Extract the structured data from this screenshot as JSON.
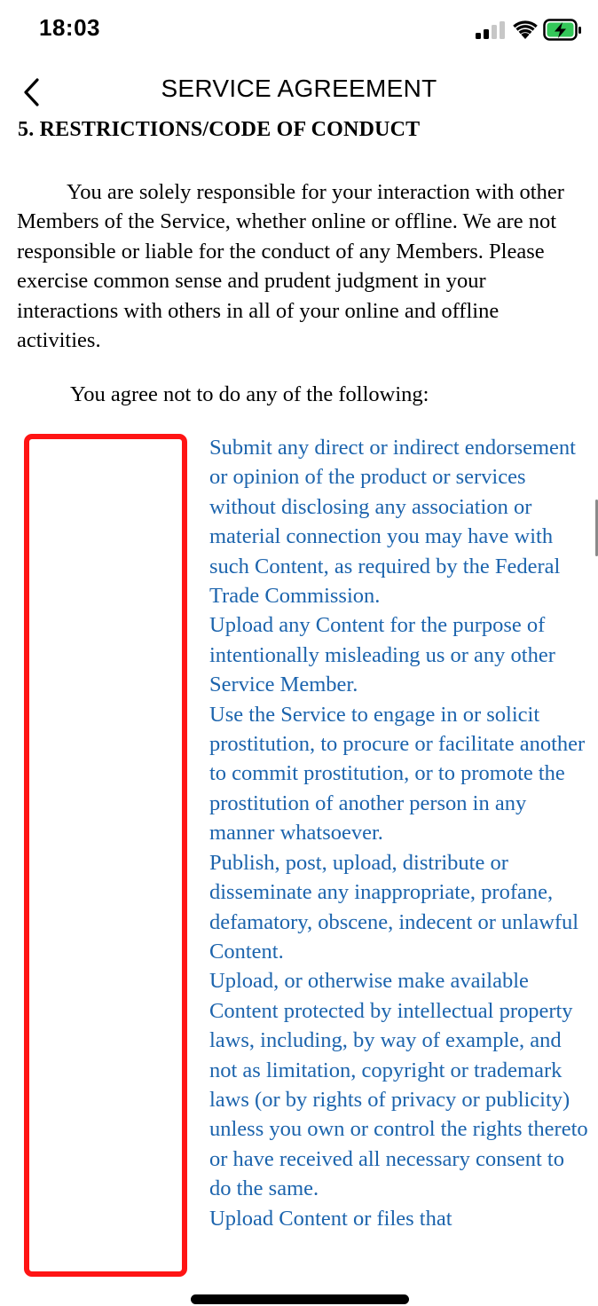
{
  "status_bar": {
    "time": "18:03",
    "icons": [
      "signal-icon",
      "wifi-icon",
      "battery-charging-icon"
    ]
  },
  "header": {
    "title": "SERVICE AGREEMENT",
    "back_icon": "chevron-left-icon"
  },
  "document": {
    "section_heading": "5.  RESTRICTIONS/CODE OF CONDUCT",
    "paragraphs": [
      "You are solely responsible for your interaction with other Members of the Service, whether online or offline. We are not responsible or liable for the conduct of any Members. Please exercise common sense and prudent judgment in your interactions with others in all of your online and offline activities.",
      "You agree not to do any of the following:"
    ],
    "restrictions": [
      "Submit any direct or indirect endorsement or opinion of the product or services without disclosing any association or material connection you may have with such Content, as required by the Federal Trade Commission.",
      "Upload any Content for the purpose of intentionally misleading us or any other Service Member.",
      "Use the Service to engage in or solicit prostitution, to procure or facilitate another to commit prostitution, or to promote the prostitution of another person in any manner whatsoever.",
      "Publish, post, upload, distribute or disseminate any inappropriate, profane, defamatory, obscene, indecent or unlawful Content.",
      "Upload, or otherwise make available Content protected by intellectual property laws, including, by way of example, and not as limitation, copyright or trademark laws (or by rights of privacy or publicity) unless you own or control the rights thereto or have received all necessary consent to do the same.",
      "Upload Content or files that"
    ]
  },
  "colors": {
    "link_text": "#1c64ad",
    "highlight_border": "#ff1414",
    "battery_charging": "#34c759"
  }
}
